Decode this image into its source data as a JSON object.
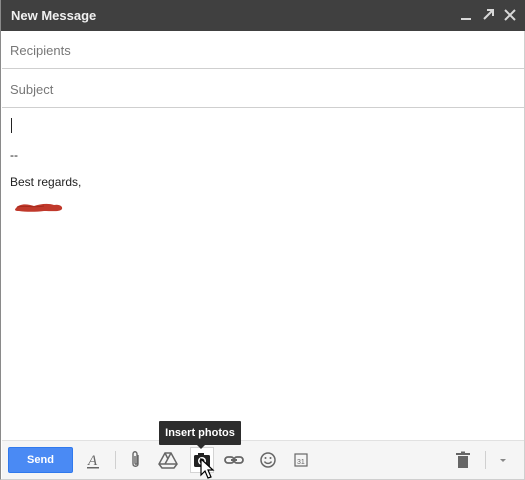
{
  "window": {
    "title": "New Message",
    "titlebar_color": "#404040"
  },
  "fields": {
    "recipients_placeholder": "Recipients",
    "subject_placeholder": "Subject"
  },
  "body": {
    "signature_separator": "--",
    "signature_closing": "Best regards,",
    "signature_name_redacted": true
  },
  "toolbar": {
    "send_label": "Send",
    "send_color": "#4a8af4",
    "icons": [
      "formatting-icon",
      "attach-icon",
      "drive-icon",
      "camera-icon",
      "link-icon",
      "emoji-icon",
      "calendar-icon",
      "trash-icon",
      "more-options-icon"
    ]
  },
  "tooltip": {
    "text": "Insert photos"
  },
  "redaction_color": "#c0392b"
}
